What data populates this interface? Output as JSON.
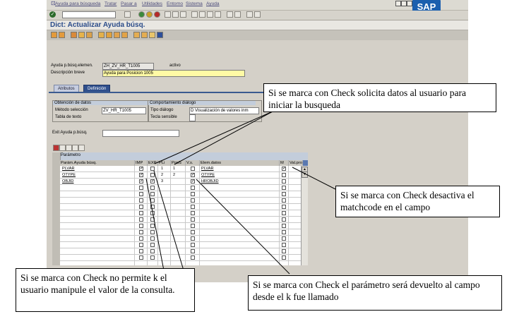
{
  "menubar": {
    "items": [
      "Ayuda para búsqueda",
      "Tratar",
      "Pasar a",
      "Utilidades",
      "Entorno",
      "Sistema",
      "Ayuda"
    ]
  },
  "logo": "SAP",
  "screen": {
    "title": "Dict: Actualizar Ayuda búsq."
  },
  "header": {
    "name_label": "Ayuda p.búsq.elemen.",
    "name_value": "ZH_ZV_HR_T1005",
    "status": "activo",
    "desc_label": "Descripción breve",
    "desc_value": "Ayuda para Posicion 1005"
  },
  "tabs": [
    "Atributos",
    "Definición"
  ],
  "data_retrieval": {
    "title": "Obtención de datos",
    "method_label": "Método selección",
    "method_value": "ZV_HR_T1005",
    "text_table_label": "Tabla de texto"
  },
  "dialog_behavior": {
    "title": "Comportamiento diálogo",
    "type_label": "Tipo diálogo",
    "type_value": "D Visualización de valores inm",
    "hotkey_label": "Tecla sensible"
  },
  "exit": {
    "label": "Exit Ayuda p.búsq."
  },
  "params": {
    "section_title": "Parámetro",
    "columns": [
      "Parám.Ayuda búsq.",
      "IMP",
      "EXP",
      "PLi",
      "PosS",
      "V.s.",
      "Elem.datos",
      "M",
      "Val.prop."
    ],
    "rows": [
      {
        "param": "PLVAR",
        "imp": true,
        "exp": false,
        "pli": "1",
        "poss": "1",
        "vs": false,
        "elem": "PLVAR",
        "m": true
      },
      {
        "param": "OTYPE",
        "imp": true,
        "exp": false,
        "pli": "2",
        "poss": "2",
        "vs": true,
        "elem": "OTYPE",
        "m": false
      },
      {
        "param": "OBJID",
        "imp": true,
        "exp": true,
        "pli": "3",
        "poss": "",
        "vs": true,
        "elem": "HROBJID",
        "m": false
      }
    ]
  },
  "callouts": {
    "top": "Si se marca con Check solicita datos al usuario para iniciar la busqueda",
    "right": "Si se marca con Check desactiva el matchcode en el campo",
    "bottom_left": "Si se marca con Check no permite k el usuario manipule el valor de la consulta.",
    "bottom_right": "Si se marca con Check el parámetro será devuelto al campo desde el k fue llamado"
  }
}
